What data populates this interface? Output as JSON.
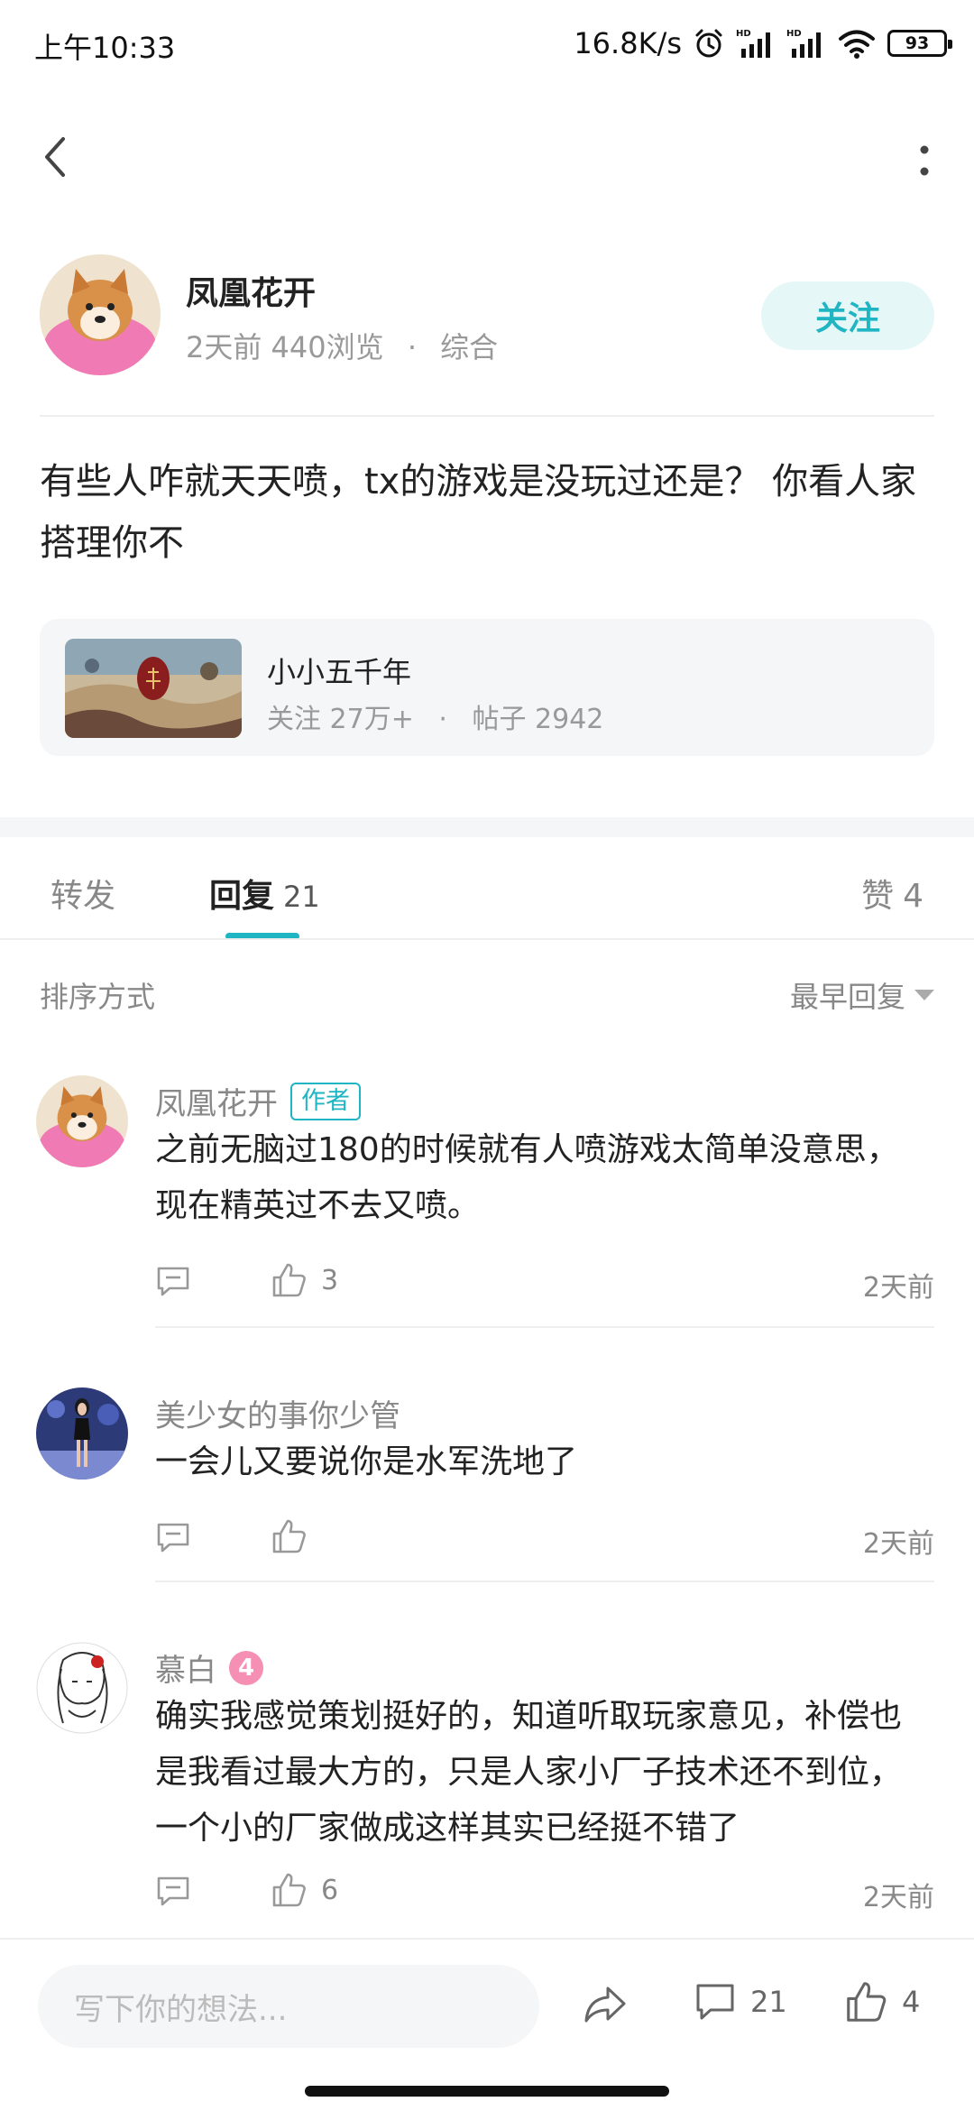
{
  "status_bar": {
    "time": "上午10:33",
    "network_speed": "16.8K/s",
    "battery": "93",
    "icons": [
      "alarm-icon",
      "signal-hd-icon",
      "signal-hd-icon",
      "wifi-icon",
      "battery-icon"
    ]
  },
  "nav": {
    "back_icon": "chevron-left-icon",
    "more_icon": "more-vertical-icon"
  },
  "post": {
    "author": {
      "name": "凤凰花开",
      "time_ago": "2天前",
      "views": "440浏览",
      "separator": "·",
      "category": "综合"
    },
    "follow_label": "关注",
    "content": "有些人咋就天天喷，tx的游戏是没玩过还是？ 你看人家搭理你不",
    "circle": {
      "name": "小小五千年",
      "followers_label": "关注 27万+",
      "separator": "·",
      "posts_label": "帖子 2942"
    }
  },
  "tabs": {
    "repost": "转发",
    "reply": "回复",
    "reply_count": "21",
    "like": "赞",
    "like_count": "4",
    "active": "reply"
  },
  "sort": {
    "label": "排序方式",
    "selected": "最早回复"
  },
  "comments": [
    {
      "name": "凤凰花开",
      "tag": "作者",
      "text": "之前无脑过180的时候就有人喷游戏太简单没意思，现在精英过不去又喷。",
      "likes": "3",
      "time": "2天前"
    },
    {
      "name": "美少女的事你少管",
      "text": "一会儿又要说你是水军洗地了",
      "likes": "",
      "time": "2天前"
    },
    {
      "name": "慕白",
      "level": "4",
      "text": "确实我感觉策划挺好的，知道听取玩家意见，补偿也是我看过最大方的，只是人家小厂子技术还不到位，一个小的厂家做成这样其实已经挺不错了",
      "likes": "6",
      "time": "2天前"
    }
  ],
  "bottom_bar": {
    "input_placeholder": "写下你的想法...",
    "comment_count": "21",
    "like_count": "4"
  },
  "colors": {
    "accent": "#1fb5c2",
    "follow_bg": "#e6f7f8",
    "level_badge": "#f58fb4",
    "muted_text": "#888888"
  }
}
